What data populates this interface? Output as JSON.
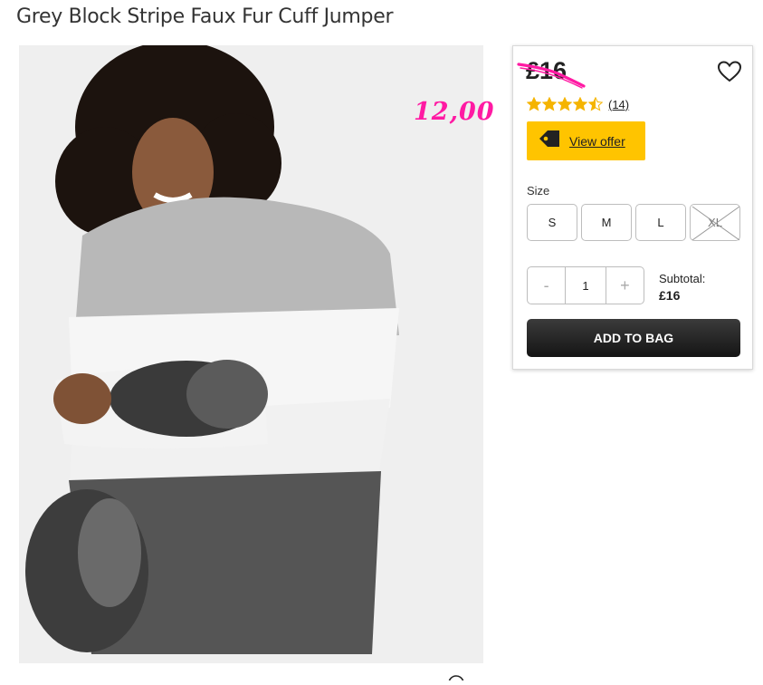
{
  "product": {
    "title": "Grey Block Stripe Faux Fur Cuff Jumper"
  },
  "annotation": {
    "handwritten_price": "12,00",
    "color": "#ff1aa3"
  },
  "panel": {
    "price": "£16",
    "rating": {
      "stars": 4.5,
      "reviews_label": "(14)",
      "star_color": "#f5b400"
    },
    "offer": {
      "label": "View offer",
      "icon": "tag-icon",
      "color": "#ffc400"
    },
    "size_label": "Size",
    "sizes": [
      {
        "label": "S",
        "available": true
      },
      {
        "label": "M",
        "available": true
      },
      {
        "label": "L",
        "available": true
      },
      {
        "label": "XL",
        "available": false
      }
    ],
    "quantity": {
      "minus": "-",
      "value": "1",
      "plus": "+"
    },
    "subtotal": {
      "label": "Subtotal:",
      "amount": "£16"
    },
    "add_to_bag": "ADD TO BAG"
  },
  "icons": {
    "wishlist": "heart-icon",
    "zoom": "zoom-icon"
  }
}
